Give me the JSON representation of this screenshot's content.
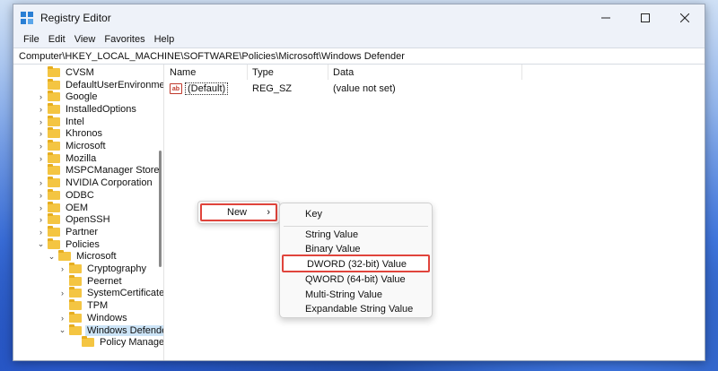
{
  "window": {
    "title": "Registry Editor",
    "menu": [
      "File",
      "Edit",
      "View",
      "Favorites",
      "Help"
    ],
    "address": "Computer\\HKEY_LOCAL_MACHINE\\SOFTWARE\\Policies\\Microsoft\\Windows Defender"
  },
  "tree": {
    "items": [
      {
        "label": "CVSM",
        "expand": "",
        "level": 0
      },
      {
        "label": "DefaultUserEnvironment",
        "expand": "",
        "level": 0
      },
      {
        "label": "Google",
        "expand": "›",
        "level": 0
      },
      {
        "label": "InstalledOptions",
        "expand": "›",
        "level": 0
      },
      {
        "label": "Intel",
        "expand": "›",
        "level": 0
      },
      {
        "label": "Khronos",
        "expand": "›",
        "level": 0
      },
      {
        "label": "Microsoft",
        "expand": "›",
        "level": 0
      },
      {
        "label": "Mozilla",
        "expand": "›",
        "level": 0
      },
      {
        "label": "MSPCManager Store",
        "expand": "",
        "level": 0
      },
      {
        "label": "NVIDIA Corporation",
        "expand": "›",
        "level": 0
      },
      {
        "label": "ODBC",
        "expand": "›",
        "level": 0
      },
      {
        "label": "OEM",
        "expand": "›",
        "level": 0
      },
      {
        "label": "OpenSSH",
        "expand": "›",
        "level": 0
      },
      {
        "label": "Partner",
        "expand": "›",
        "level": 0
      },
      {
        "label": "Policies",
        "expand": "⌄",
        "level": 0
      },
      {
        "label": "Microsoft",
        "expand": "⌄",
        "level": 1
      },
      {
        "label": "Cryptography",
        "expand": "›",
        "level": 2
      },
      {
        "label": "Peernet",
        "expand": "",
        "level": 2
      },
      {
        "label": "SystemCertificates",
        "expand": "›",
        "level": 2
      },
      {
        "label": "TPM",
        "expand": "",
        "level": 2
      },
      {
        "label": "Windows",
        "expand": "›",
        "level": 2
      },
      {
        "label": "Windows Defender",
        "expand": "⌄",
        "level": 2,
        "selected": true
      },
      {
        "label": "Policy Manager",
        "expand": "",
        "level": 3
      }
    ]
  },
  "list": {
    "columns": [
      "Name",
      "Type",
      "Data"
    ],
    "rows": [
      {
        "icon": "ab",
        "name": "(Default)",
        "type": "REG_SZ",
        "data": "(value not set)"
      }
    ]
  },
  "context_menu": {
    "new_label": "New",
    "new_arrow": "›"
  },
  "submenu": {
    "items": [
      "Key",
      "String Value",
      "Binary Value",
      "DWORD (32-bit) Value",
      "QWORD (64-bit) Value",
      "Multi-String Value",
      "Expandable String Value"
    ]
  },
  "colors": {
    "highlight": "#e0443c",
    "selection": "#cce4f7",
    "folder": "#f4c542"
  }
}
